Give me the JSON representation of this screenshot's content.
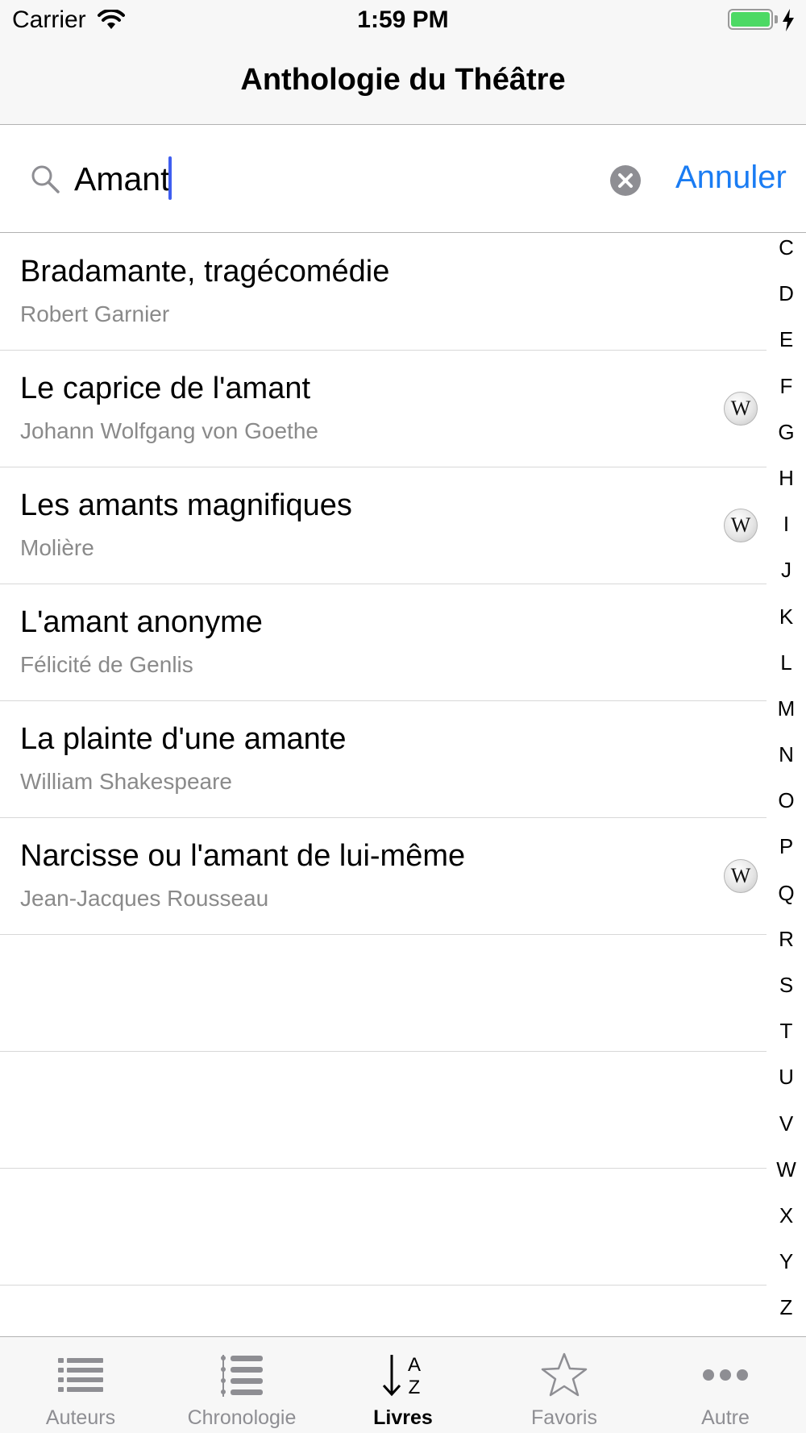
{
  "status_bar": {
    "carrier": "Carrier",
    "time": "1:59 PM",
    "icons": [
      "wifi-icon",
      "battery-icon",
      "charging-bolt-icon"
    ],
    "battery_color": "#4cd964"
  },
  "nav": {
    "title": "Anthologie du Théâtre"
  },
  "search": {
    "value": "Amant",
    "cancel_label": "Annuler",
    "icons": [
      "search-icon",
      "clear-icon"
    ],
    "accent_color": "#1a7cf3"
  },
  "results": [
    {
      "title": "Bradamante, tragécomédie",
      "author": "Robert Garnier",
      "wiki": false
    },
    {
      "title": "Le caprice de l'amant",
      "author": "Johann Wolfgang von Goethe",
      "wiki": true
    },
    {
      "title": "Les amants magnifiques",
      "author": "Molière",
      "wiki": true
    },
    {
      "title": "L'amant anonyme",
      "author": "Félicité de Genlis",
      "wiki": false
    },
    {
      "title": "La plainte d'une amante",
      "author": "William Shakespeare",
      "wiki": false
    },
    {
      "title": "Narcisse ou l'amant de lui-même",
      "author": "Jean-Jacques Rousseau",
      "wiki": true
    }
  ],
  "wiki_icon_glyph": "W",
  "index": [
    "C",
    "D",
    "E",
    "F",
    "G",
    "H",
    "I",
    "J",
    "K",
    "L",
    "M",
    "N",
    "O",
    "P",
    "Q",
    "R",
    "S",
    "T",
    "U",
    "V",
    "W",
    "X",
    "Y",
    "Z"
  ],
  "tabs": [
    {
      "label": "Auteurs",
      "icon": "list-icon",
      "active": false
    },
    {
      "label": "Chronologie",
      "icon": "timeline-icon",
      "active": false
    },
    {
      "label": "Livres",
      "icon": "sort-az-icon",
      "active": true
    },
    {
      "label": "Favoris",
      "icon": "star-icon",
      "active": false
    },
    {
      "label": "Autre",
      "icon": "more-icon",
      "active": false
    }
  ]
}
